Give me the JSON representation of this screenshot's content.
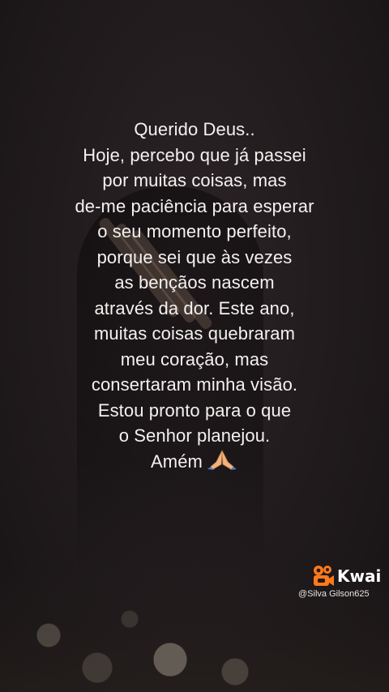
{
  "message": {
    "lines": [
      "Querido Deus..",
      "Hoje, percebo que já passei",
      "por muitas coisas, mas",
      "de-me paciência para esperar",
      "o seu momento perfeito,",
      "porque sei que às vezes",
      "as bençãos nascem",
      "através da dor. Este ano,",
      "muitas coisas quebraram",
      "meu coração, mas",
      "consertaram minha visão.",
      "Estou pronto para o que",
      "o Senhor planejou.",
      "Amém"
    ],
    "closing_icon": "praying-hands-emoji"
  },
  "watermark": {
    "brand": "Kwai",
    "handle": "@Silva Gilson625",
    "logo_icon": "kwai-camera-logo",
    "logo_color": "#ff7a1a"
  }
}
